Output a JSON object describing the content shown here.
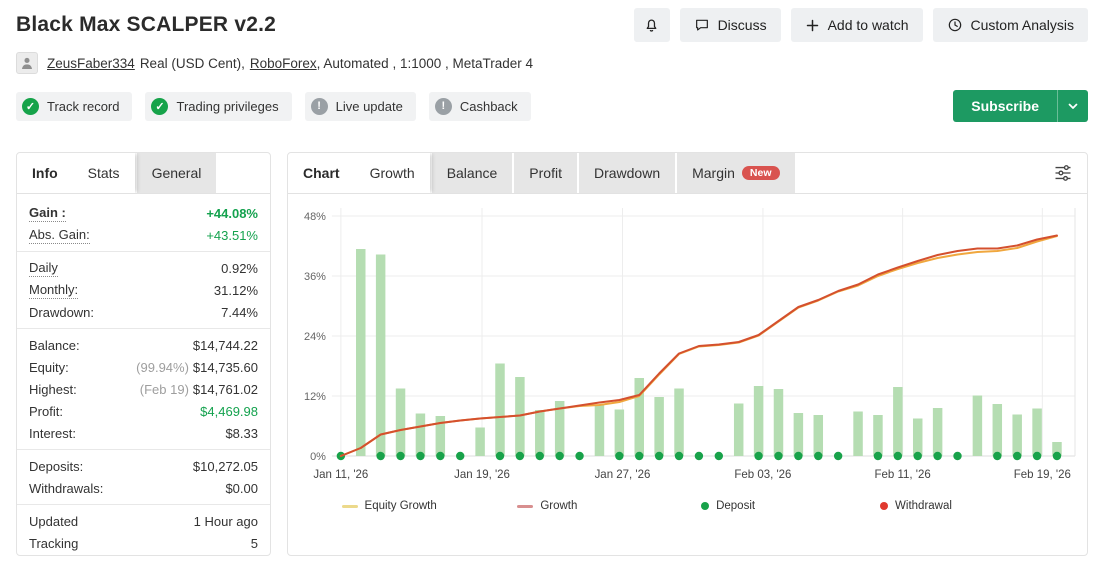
{
  "header": {
    "title": "Black Max SCALPER v2.2",
    "discuss_label": "Discuss",
    "add_watch_label": "Add to watch",
    "custom_analysis_label": "Custom Analysis",
    "user": {
      "username": "ZeusFaber334",
      "account_prefix": "Real (USD Cent),",
      "broker": "RoboForex",
      "account_suffix": ", Automated , 1:1000 , MetaTrader 4"
    },
    "badges": [
      {
        "label": "Track record",
        "status": "verified"
      },
      {
        "label": "Trading privileges",
        "status": "verified"
      },
      {
        "label": "Live update",
        "status": "info"
      },
      {
        "label": "Cashback",
        "status": "info"
      }
    ],
    "subscribe_label": "Subscribe"
  },
  "colors": {
    "accent_green": "#1d9a62",
    "gain_green": "#14a24e",
    "new_badge_red": "#d9534f",
    "bar_green": "#b5ddb2",
    "deposit_dot_green": "#18a24a",
    "withdrawal_dot_red": "#e0392f",
    "growth_line": "#d4502e",
    "equity_line": "#f0a73e"
  },
  "stats_panel": {
    "tabs": [
      {
        "label": "Info",
        "style": "bold"
      },
      {
        "label": "Stats",
        "active": true
      },
      {
        "label": "General"
      }
    ],
    "groups": [
      {
        "rows": [
          {
            "label": "Gain :",
            "dotted": true,
            "label_bold": true,
            "value": "+44.08%",
            "green": true,
            "bold": true
          },
          {
            "label": "Abs. Gain:",
            "dotted": true,
            "value": "+43.51%",
            "green": true
          }
        ]
      },
      {
        "rows": [
          {
            "label": "Daily",
            "dotted": true,
            "value": "0.92%"
          },
          {
            "label": "Monthly:",
            "dotted": true,
            "value": "31.12%"
          },
          {
            "label": "Drawdown:",
            "value": "7.44%"
          }
        ]
      },
      {
        "rows": [
          {
            "label": "Balance:",
            "value": "$14,744.22"
          },
          {
            "label": "Equity:",
            "prefix": "(99.94%)",
            "value": "$14,735.60"
          },
          {
            "label": "Highest:",
            "prefix": "(Feb 19)",
            "value": "$14,761.02"
          },
          {
            "label": "Profit:",
            "value": "$4,469.98",
            "green": true
          },
          {
            "label": "Interest:",
            "value": "$8.33"
          }
        ]
      },
      {
        "rows": [
          {
            "label": "Deposits:",
            "value": "$10,272.05"
          },
          {
            "label": "Withdrawals:",
            "value": "$0.00"
          }
        ]
      },
      {
        "rows": [
          {
            "label": "Updated",
            "value": "1 Hour ago"
          },
          {
            "label": "Tracking",
            "value": "5"
          }
        ]
      }
    ]
  },
  "chart_panel": {
    "tabs": [
      {
        "label": "Chart",
        "style": "bold"
      },
      {
        "label": "Growth",
        "active": true
      },
      {
        "label": "Balance"
      },
      {
        "label": "Profit"
      },
      {
        "label": "Drawdown"
      },
      {
        "label": "Margin",
        "badge": "New"
      }
    ],
    "legend": [
      {
        "label": "Equity Growth",
        "type": "line",
        "color": "#ecd98b",
        "frac": 0.067
      },
      {
        "label": "Growth",
        "type": "line",
        "color": "#d88f8f",
        "frac": 0.287
      },
      {
        "label": "Deposit",
        "type": "dot",
        "color": "#18a24a",
        "frac": 0.517
      },
      {
        "label": "Withdrawal",
        "type": "dot",
        "color": "#e0392f",
        "frac": 0.741
      }
    ],
    "chart_data": {
      "type": "line",
      "ylim": [
        0,
        48
      ],
      "ytick_values": [
        0,
        12,
        24,
        36,
        48
      ],
      "ytick_labels": [
        "0%",
        "12%",
        "24%",
        "36%",
        "48%"
      ],
      "xticks": [
        {
          "label": "Jan 11, '26",
          "frac": 0.012
        },
        {
          "label": "Jan 19, '26",
          "frac": 0.202
        },
        {
          "label": "Jan 27, '26",
          "frac": 0.391
        },
        {
          "label": "Feb 03, '26",
          "frac": 0.58
        },
        {
          "label": "Feb 11, '26",
          "frac": 0.768
        },
        {
          "label": "Feb 19, '26",
          "frac": 0.956
        }
      ],
      "x_start_frac": 0.012,
      "x_step_frac": 0.02677,
      "grid": true,
      "series": [
        {
          "name": "Equity Growth",
          "color": "#f0a73e",
          "values": [
            0,
            1.6,
            4.3,
            5.2,
            5.9,
            6.6,
            7.1,
            7.5,
            7.8,
            8.1,
            8.9,
            9.5,
            10.0,
            10.2,
            10.8,
            12.0,
            16.3,
            20.4,
            21.9,
            22.2,
            22.7,
            24.1,
            26.9,
            29.7,
            31.1,
            32.9,
            34.1,
            36.0,
            37.4,
            38.6,
            39.6,
            40.3,
            40.8,
            41.0,
            41.6,
            42.9,
            44.0
          ]
        },
        {
          "name": "Growth",
          "color": "#d4502e",
          "values": [
            0,
            1.6,
            4.3,
            5.2,
            5.9,
            6.6,
            7.1,
            7.5,
            7.8,
            8.1,
            8.9,
            9.5,
            10.1,
            10.7,
            11.2,
            12.2,
            16.5,
            20.5,
            22.0,
            22.3,
            22.8,
            24.2,
            27.0,
            29.8,
            31.2,
            33.0,
            34.3,
            36.3,
            37.7,
            39.0,
            40.2,
            41.0,
            41.5,
            41.5,
            42.1,
            43.3,
            44.1
          ]
        }
      ],
      "bars": {
        "name": "Daily bars",
        "color": "#b5ddb2",
        "values": [
          0,
          41.4,
          40.3,
          13.5,
          8.5,
          8.0,
          0,
          5.7,
          18.5,
          15.8,
          9.2,
          11.0,
          0,
          10.3,
          9.3,
          15.6,
          11.8,
          13.5,
          0,
          0,
          10.5,
          14.0,
          13.4,
          8.6,
          8.2,
          0,
          8.9,
          8.2,
          13.8,
          7.5,
          9.6,
          0,
          12.1,
          10.4,
          8.3,
          9.5,
          2.8
        ]
      },
      "deposit_dots": [
        1,
        0,
        1,
        1,
        1,
        1,
        1,
        0,
        1,
        1,
        1,
        1,
        1,
        0,
        1,
        1,
        1,
        1,
        1,
        1,
        0,
        1,
        1,
        1,
        1,
        1,
        0,
        1,
        1,
        1,
        1,
        1,
        0,
        1,
        1,
        1,
        1
      ],
      "deposit_dot_color": "#18a24a"
    }
  }
}
